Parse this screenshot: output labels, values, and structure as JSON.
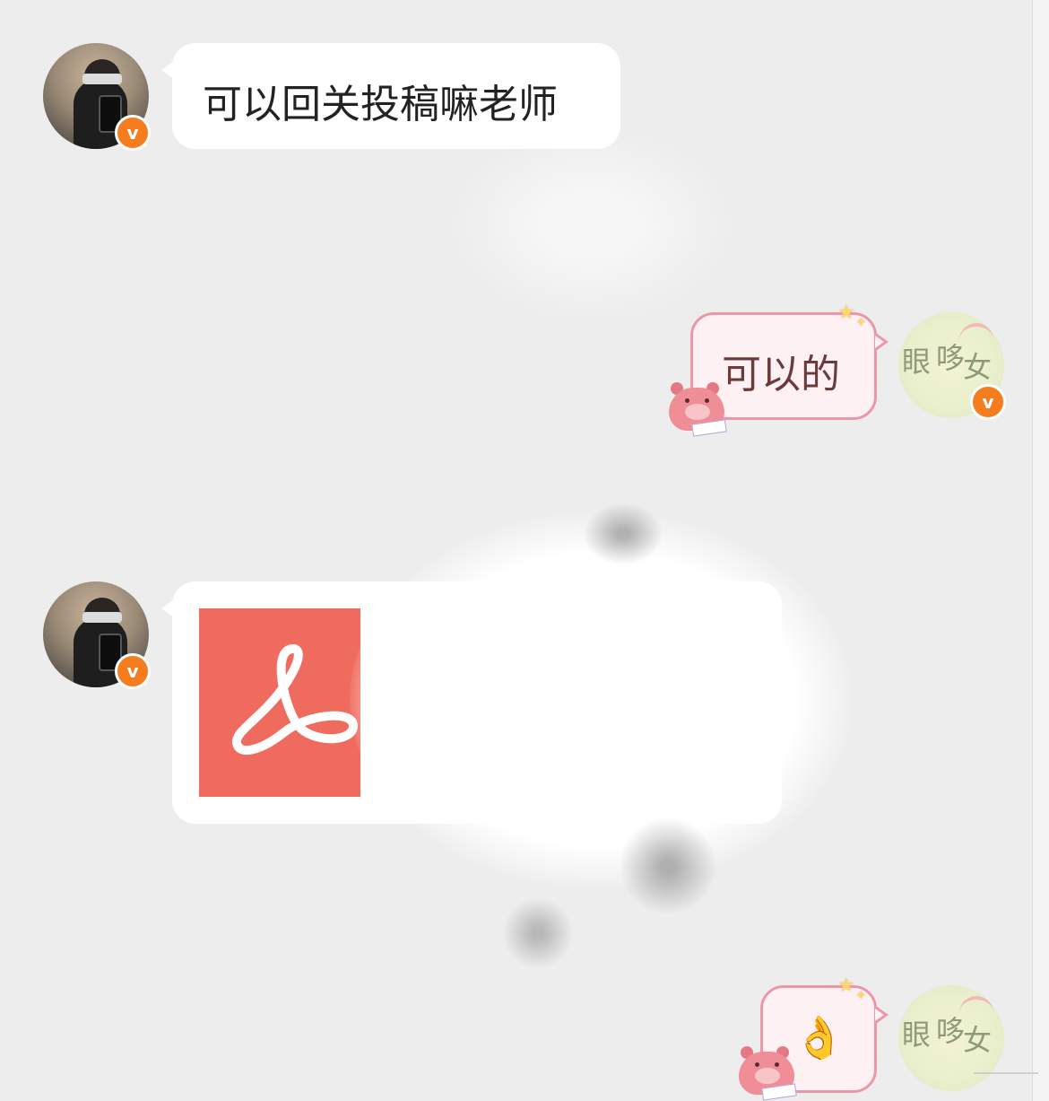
{
  "messages": [
    {
      "side": "left",
      "kind": "text",
      "text": "可以回关投稿嘛老师"
    },
    {
      "side": "right",
      "kind": "text",
      "text": "可以的"
    },
    {
      "side": "left",
      "kind": "file",
      "file_type": "pdf",
      "icon": "adobe-pdf-icon"
    },
    {
      "side": "right",
      "kind": "emoji",
      "text": "👌"
    }
  ],
  "badge": {
    "letter": "v",
    "color": "#f57c1f"
  },
  "colors": {
    "background": "#ededed",
    "outgoing_border": "#ec97a8",
    "outgoing_fill": "#fdf1f3",
    "pdf_red": "#ef6b5d"
  }
}
